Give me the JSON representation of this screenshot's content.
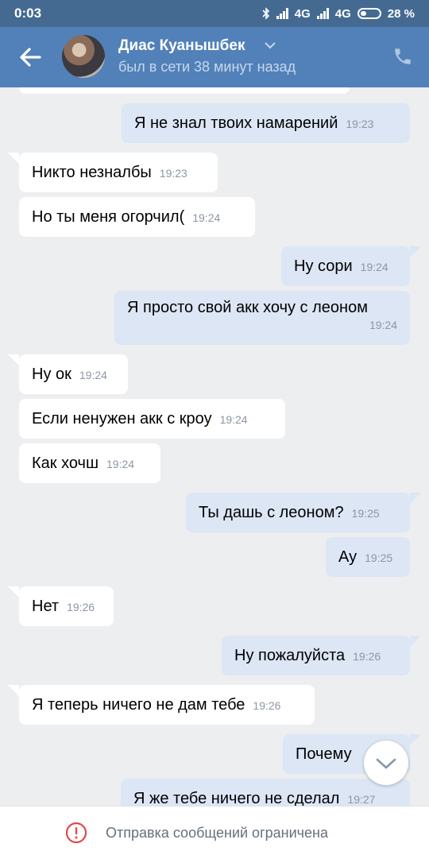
{
  "status_bar": {
    "time": "0:03",
    "net1": "4G",
    "net2": "4G",
    "battery": "28 %"
  },
  "header": {
    "name": "Диас Куанышбек",
    "last_seen": "был в сети 38 минут назад"
  },
  "messages": [
    {
      "dir": "out",
      "text": "Я не знал твоих намарений",
      "time": "19:23"
    },
    {
      "dir": "in",
      "text": "Никто незналбы",
      "time": "19:23"
    },
    {
      "dir": "in",
      "text": "Но ты меня огорчил(",
      "time": "19:24"
    },
    {
      "dir": "out",
      "text": "Ну сори",
      "time": "19:24"
    },
    {
      "dir": "out",
      "text": "Я просто свой акк хочу с леоном",
      "time": "19:24"
    },
    {
      "dir": "in",
      "text": "Ну ок",
      "time": "19:24"
    },
    {
      "dir": "in",
      "text": "Если ненужен акк с кроу",
      "time": "19:24"
    },
    {
      "dir": "in",
      "text": "Как хочш",
      "time": "19:24"
    },
    {
      "dir": "out",
      "text": "Ты дашь с леоном?",
      "time": "19:25"
    },
    {
      "dir": "out",
      "text": "Ау",
      "time": "19:25"
    },
    {
      "dir": "in",
      "text": "Нет",
      "time": "19:26"
    },
    {
      "dir": "out",
      "text": "Ну пожалуйста",
      "time": "19:26"
    },
    {
      "dir": "in",
      "text": "Я теперь ничего не дам тебе",
      "time": "19:26"
    },
    {
      "dir": "out",
      "text": "Почему",
      "time": ""
    },
    {
      "dir": "out",
      "text": "Я же тебе ничего не сделал",
      "time": "19:27"
    }
  ],
  "bottom": {
    "restriction_text": "Отправка сообщений ограничена"
  },
  "icons": {
    "back": "arrow-left-icon",
    "phone": "phone-icon",
    "scroll_down": "chevron-down-icon",
    "warning": "exclamation-circle-icon"
  },
  "colors": {
    "header": "#5181b8",
    "status_bar": "#456a92",
    "outgoing_bubble": "#dce6f5",
    "incoming_bubble": "#ffffff",
    "warning": "#e64646"
  }
}
